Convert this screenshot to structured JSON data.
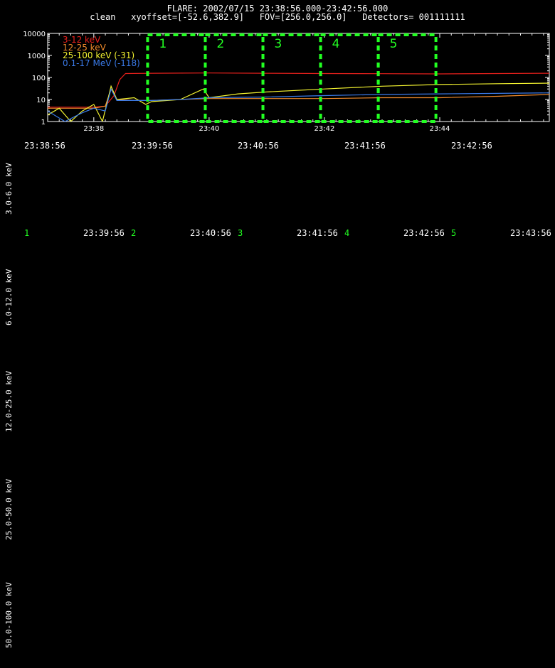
{
  "header": {
    "line1": "FLARE: 2002/07/15 23:38:56.000-23:42:56.000",
    "line2": "clean   xyoffset=[-52.6,382.9]   FOV=[256.0,256.0]   Detectors= 001111111"
  },
  "colors": {
    "background": "#000000",
    "interval": "#22ff22",
    "s1": "#e8201c",
    "s2": "#f08a2a",
    "s3": "#f2f230",
    "s4": "#3a7ae8"
  },
  "time_row": [
    "23:38:56",
    "23:39:56",
    "23:40:56",
    "23:41:56",
    "23:42:56"
  ],
  "image_row": [
    {
      "num": "1",
      "time": "23:39:56"
    },
    {
      "num": "2",
      "time": "23:40:56"
    },
    {
      "num": "3",
      "time": "23:41:56"
    },
    {
      "num": "4",
      "time": "23:42:56"
    },
    {
      "num": "5",
      "time": "23:43:56"
    }
  ],
  "energy_bands": [
    "3.0-6.0 keV",
    "6.0-12.0 keV",
    "12.0-25.0 keV",
    "25.0-50.0 keV",
    "50.0-100.0 keV"
  ],
  "chart_data": {
    "type": "line",
    "yscale": "log",
    "ylim": [
      1,
      10000
    ],
    "xlim_minutes": [
      37.2,
      45.9
    ],
    "x_tick_labels": [
      "23:38",
      "23:40",
      "23:42",
      "23:44"
    ],
    "y_tick_labels": [
      "1",
      "10",
      "100",
      "1000",
      "10000"
    ],
    "legend_position": "top-left",
    "intervals": [
      {
        "label": "1",
        "start": "23:38:56",
        "end": "23:39:56"
      },
      {
        "label": "2",
        "start": "23:39:56",
        "end": "23:40:56"
      },
      {
        "label": "3",
        "start": "23:40:56",
        "end": "23:41:56"
      },
      {
        "label": "4",
        "start": "23:41:56",
        "end": "23:42:56"
      },
      {
        "label": "5",
        "start": "23:42:56",
        "end": "23:43:56"
      }
    ],
    "series": [
      {
        "name": "3-12 keV",
        "color": "#e8201c",
        "points": [
          [
            37.2,
            4.5
          ],
          [
            37.6,
            4.5
          ],
          [
            38.0,
            4.5
          ],
          [
            38.2,
            5
          ],
          [
            38.35,
            15
          ],
          [
            38.45,
            80
          ],
          [
            38.55,
            150
          ],
          [
            39.0,
            155
          ],
          [
            40.0,
            160
          ],
          [
            41.0,
            155
          ],
          [
            42.0,
            150
          ],
          [
            43.0,
            148
          ],
          [
            44.0,
            145
          ],
          [
            45.0,
            150
          ],
          [
            45.9,
            155
          ]
        ]
      },
      {
        "name": "12-25 keV",
        "color": "#f08a2a",
        "points": [
          [
            37.2,
            4
          ],
          [
            37.6,
            4
          ],
          [
            38.0,
            4
          ],
          [
            38.2,
            5
          ],
          [
            38.3,
            30
          ],
          [
            38.4,
            10
          ],
          [
            38.7,
            9
          ],
          [
            39.0,
            9
          ],
          [
            39.5,
            10
          ],
          [
            40.0,
            11
          ],
          [
            41.0,
            11
          ],
          [
            42.0,
            11
          ],
          [
            43.0,
            12
          ],
          [
            44.0,
            12
          ],
          [
            45.0,
            14
          ],
          [
            45.9,
            17
          ]
        ]
      },
      {
        "name": "25-100 keV (-31)",
        "color": "#f2f230",
        "points": [
          [
            37.2,
            2
          ],
          [
            37.4,
            4
          ],
          [
            37.6,
            1
          ],
          [
            37.8,
            3
          ],
          [
            38.0,
            6
          ],
          [
            38.15,
            1
          ],
          [
            38.3,
            40
          ],
          [
            38.4,
            10
          ],
          [
            38.7,
            12
          ],
          [
            38.9,
            6
          ],
          [
            39.0,
            8
          ],
          [
            39.5,
            10
          ],
          [
            39.9,
            30
          ],
          [
            40.0,
            12
          ],
          [
            40.5,
            18
          ],
          [
            41.0,
            22
          ],
          [
            42.0,
            30
          ],
          [
            43.0,
            40
          ],
          [
            44.0,
            48
          ],
          [
            45.0,
            52
          ],
          [
            45.9,
            55
          ]
        ]
      },
      {
        "name": "0.1-17 MeV (-118)",
        "color": "#3a7ae8",
        "points": [
          [
            37.2,
            3
          ],
          [
            37.5,
            1
          ],
          [
            37.8,
            2.5
          ],
          [
            38.0,
            4
          ],
          [
            38.2,
            3
          ],
          [
            38.3,
            30
          ],
          [
            38.4,
            9
          ],
          [
            38.7,
            9
          ],
          [
            39.0,
            9
          ],
          [
            39.5,
            10
          ],
          [
            40.0,
            12
          ],
          [
            41.0,
            13
          ],
          [
            42.0,
            15
          ],
          [
            43.0,
            17
          ],
          [
            44.0,
            18
          ],
          [
            45.0,
            19
          ],
          [
            45.9,
            20
          ]
        ]
      }
    ]
  }
}
